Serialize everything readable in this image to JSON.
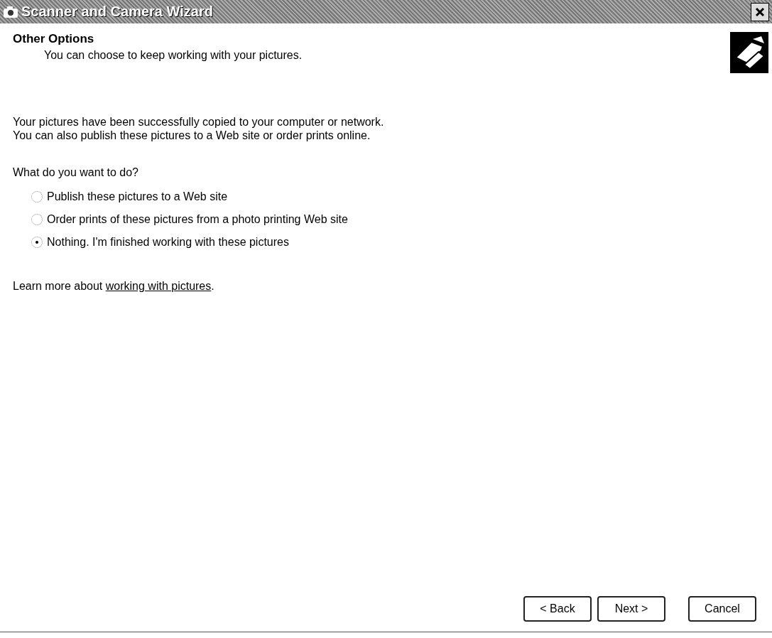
{
  "window": {
    "title": "Scanner and Camera Wizard"
  },
  "header": {
    "title": "Other Options",
    "subtitle": "You can choose to keep working with your pictures."
  },
  "body": {
    "paragraph_lines": [
      "Your pictures have been successfully copied to your computer or network.",
      "You can also publish these pictures to a Web site or order prints online."
    ],
    "question": "What do you want to do?",
    "options": [
      {
        "label": "Publish these pictures to a Web site",
        "selected": false
      },
      {
        "label": "Order prints of these pictures from a photo printing Web site",
        "selected": false
      },
      {
        "label": "Nothing. I'm finished working with these pictures",
        "selected": true
      }
    ],
    "learn_more": {
      "text": "Learn more about ",
      "link": "working with pictures",
      "after": "."
    }
  },
  "buttons": [
    {
      "label": "< Back",
      "kind": "back"
    },
    {
      "label": "Next >",
      "kind": "next"
    },
    {
      "label": "Cancel",
      "kind": "cancel"
    }
  ]
}
